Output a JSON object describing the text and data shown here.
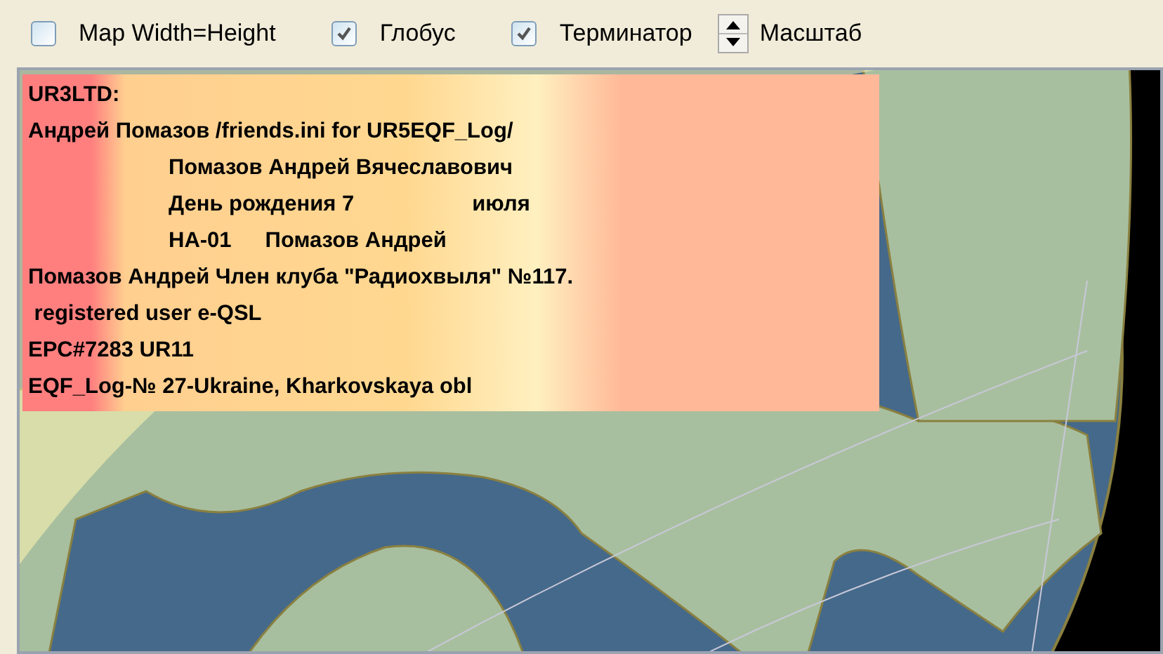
{
  "toolbar": {
    "options": [
      {
        "label": "Map Width=Height",
        "checked": false
      },
      {
        "label": "Глобус",
        "checked": true
      },
      {
        "label": "Терминатор",
        "checked": true
      }
    ],
    "scale_label": "Масштаб"
  },
  "info_lines": [
    {
      "indent": false,
      "parts": [
        "UR3LTD:"
      ]
    },
    {
      "indent": false,
      "parts": [
        "Андрей Помазов /friends.ini for UR5EQF_Log/"
      ]
    },
    {
      "indent": true,
      "parts": [
        "Помазов Андрей Вячеславович"
      ]
    },
    {
      "indent": true,
      "parts": [
        "День рождения 7",
        "июля"
      ]
    },
    {
      "indent": true,
      "parts": [
        "HA-01",
        "Помазов Андрей"
      ]
    },
    {
      "indent": false,
      "parts": [
        "Помазов Андрей Член клуба \"Радиохвыля\" №117."
      ]
    },
    {
      "indent": false,
      "parts": [
        " registered user e-QSL"
      ]
    },
    {
      "indent": false,
      "parts": [
        "EPC#7283 UR11"
      ]
    },
    {
      "indent": false,
      "parts": [
        "EQF_Log-№ 27-Ukraine, Kharkovskaya obl"
      ]
    }
  ]
}
